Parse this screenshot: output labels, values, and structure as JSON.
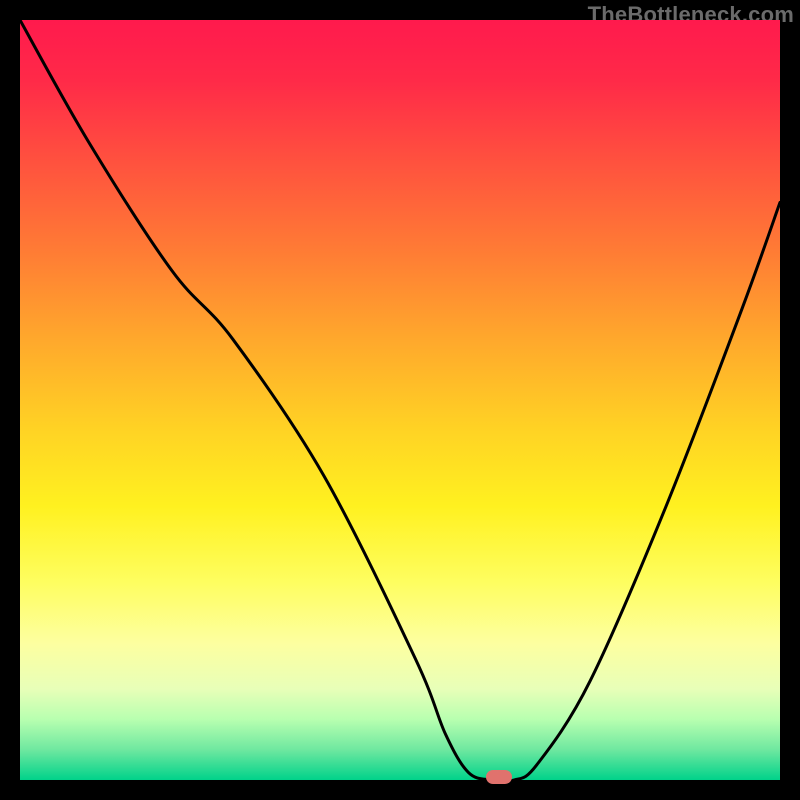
{
  "watermark": {
    "text": "TheBottleneck.com"
  },
  "colors": {
    "marker": "#e0726d",
    "curve_stroke": "#000000",
    "frame_bg": "#000000"
  },
  "chart_data": {
    "type": "line",
    "title": "",
    "xlabel": "",
    "ylabel": "",
    "xlim": [
      0,
      100
    ],
    "ylim": [
      0,
      100
    ],
    "grid": false,
    "legend": false,
    "series": [
      {
        "name": "bottleneck-curve",
        "x": [
          0,
          9,
          20,
          28,
          40,
          52,
          56,
          59,
          62,
          65,
          68,
          75,
          85,
          95,
          100
        ],
        "values": [
          100,
          84,
          67,
          58,
          40,
          16,
          6,
          1,
          0,
          0,
          2,
          13,
          36,
          62,
          76
        ]
      }
    ],
    "annotations": [
      {
        "name": "optimal-marker",
        "x": 63,
        "y": 0
      }
    ]
  }
}
